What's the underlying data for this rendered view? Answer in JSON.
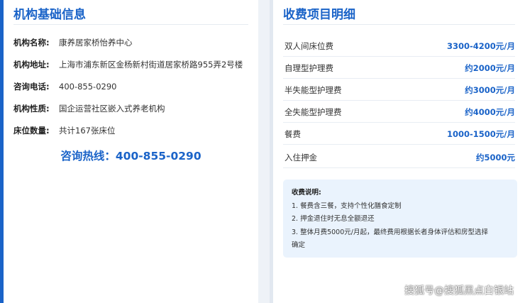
{
  "left_card": {
    "title": "机构基础信息",
    "rows": [
      {
        "label": "机构名称:",
        "value": "康养居家桥怡养中心"
      },
      {
        "label": "机构地址:",
        "value": "上海市浦东新区金杨新村街道居家桥路955弄2号楼"
      },
      {
        "label": "咨询电话:",
        "value": "400-855-0290"
      },
      {
        "label": "机构性质:",
        "value": "国企运营社区嵌入式养老机构"
      },
      {
        "label": "床位数量:",
        "value": "共计167张床位"
      }
    ],
    "hotline": "咨询热线：400-855-0290"
  },
  "right_card": {
    "title": "收费项目明细",
    "fees": [
      {
        "name": "双人间床位费",
        "price": "3300-4200元/月"
      },
      {
        "name": "自理型护理费",
        "price": "约2000元/月"
      },
      {
        "name": "半失能型护理费",
        "price": "约3000元/月"
      },
      {
        "name": "全失能型护理费",
        "price": "约4000元/月"
      },
      {
        "name": "餐费",
        "price": "1000-1500元/月"
      },
      {
        "name": "入住押金",
        "price": "约5000元"
      }
    ],
    "note": {
      "title": "收费说明:",
      "lines": [
        "1. 餐费含三餐，支持个性化膳食定制",
        "2. 押金退住时无息全额退还",
        "3. 整体月费5000元/月起，最终费用根据长者身体评估和房型选择",
        "确定"
      ]
    }
  },
  "watermark": "搜狐号@搜狐黑点白银站",
  "colors": {
    "accent": "#1a63c8",
    "note_bg": "#eaf3fd"
  }
}
